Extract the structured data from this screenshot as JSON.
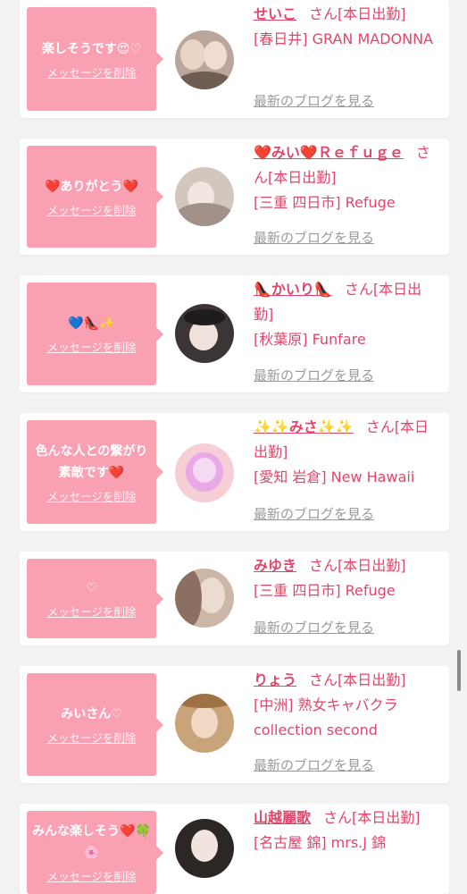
{
  "labels": {
    "delete": "メッセージを削除",
    "latest_blog": "最新のブログを見る",
    "san": "さん",
    "on_duty": "[本日出勤]"
  },
  "cards": [
    {
      "message": "楽しそうです😍♡",
      "name": "せいこ",
      "store": "[春日井] GRAN MADONNA"
    },
    {
      "message": "❤️ありがとう❤️",
      "name": "❤️みい❤️Ｒｅｆｕｇｅ",
      "store": "[三重 四日市] Refuge"
    },
    {
      "message": "💙👠✨",
      "name": "👠かいり👠",
      "store": "[秋葉原] Funfare"
    },
    {
      "message": "色んな人との繋がり素敵です❤️",
      "name": "✨✨みさ✨✨",
      "store": "[愛知 岩倉] New Hawaii"
    },
    {
      "message": "♡",
      "name": "みゆき",
      "store": "[三重 四日市] Refuge"
    },
    {
      "message": "みいさん♡",
      "name": "りょう",
      "store": "[中洲] 熟女キャバクラ collection second"
    },
    {
      "message": "みんな楽しそう❤️🍀🌸",
      "name": "山越麗歌",
      "store": "[名古屋 錦] mrs.J 錦"
    }
  ],
  "colors": {
    "accent": "#e0466a",
    "bubble": "#f9a0b3",
    "muted": "#9a9a9a",
    "background": "#f2f2f2"
  }
}
